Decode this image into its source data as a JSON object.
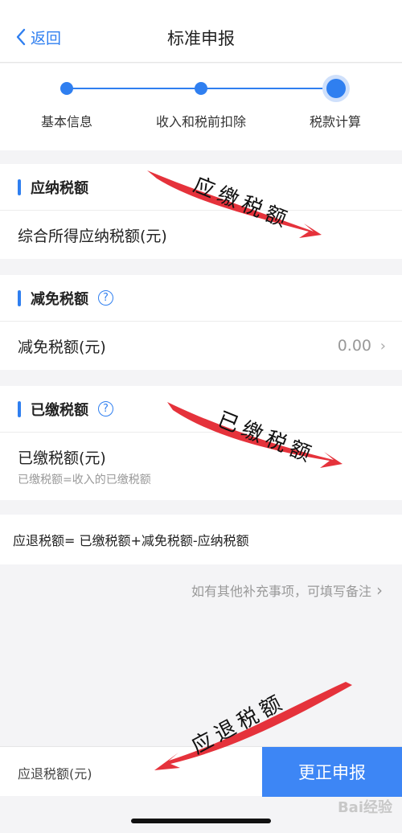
{
  "nav": {
    "back_label": "返回",
    "title": "标准申报"
  },
  "steps": [
    {
      "label": "基本信息",
      "state": "done"
    },
    {
      "label": "收入和税前扣除",
      "state": "done"
    },
    {
      "label": "税款计算",
      "state": "current"
    }
  ],
  "payable": {
    "title": "应纳税额",
    "row_label": "综合所得应纳税额(元)"
  },
  "reduction": {
    "title": "减免税额",
    "help_icon": "?",
    "row_label": "减免税额(元)",
    "row_value": "0.00"
  },
  "paid": {
    "title": "已缴税额",
    "help_icon": "?",
    "row_label": "已缴税额(元)",
    "row_sub": "已缴税额=收入的已缴税额"
  },
  "formula_text": "应退税额= 已缴税额+减免税额-应纳税额",
  "remark_link": "如有其他补充事项，可填写备注",
  "bottom": {
    "refund_label": "应退税额(元)",
    "submit_label": "更正申报"
  },
  "annotations": {
    "arrow1_text": "应缴税额",
    "arrow2_text": "已缴税额",
    "arrow3_text": "应退税额",
    "arrow_color": "#e5323b"
  },
  "watermark": "Bai经验",
  "colors": {
    "accent": "#2f7ff0",
    "submit": "#3d86f5"
  }
}
